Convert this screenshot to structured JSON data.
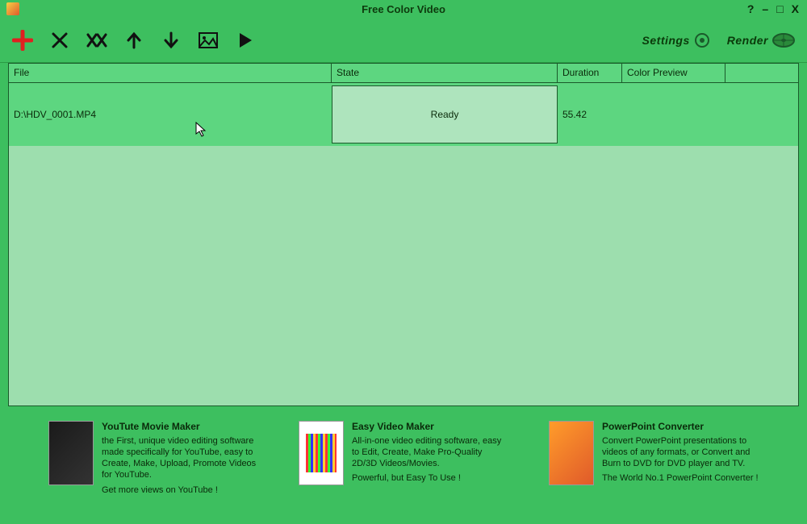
{
  "window": {
    "title": "Free Color Video"
  },
  "toolbar": {
    "settings_label": "Settings",
    "render_label": "Render"
  },
  "table": {
    "headers": {
      "file": "File",
      "state": "State",
      "duration": "Duration",
      "preview": "Color Preview"
    },
    "rows": [
      {
        "file": "D:\\HDV_0001.MP4",
        "state": "Ready",
        "duration": "55.42"
      }
    ]
  },
  "promos": [
    {
      "title": "YouTute Movie Maker",
      "desc": "the First, unique video editing software made specifically for YouTube, easy to Create, Make, Upload, Promote Videos for YouTube.",
      "tagline": "Get more views on YouTube !"
    },
    {
      "title": "Easy Video Maker",
      "desc": "All-in-one video editing software, easy to Edit, Create, Make Pro-Quality 2D/3D Videos/Movies.",
      "tagline": "Powerful, but Easy To Use !"
    },
    {
      "title": "PowerPoint Converter",
      "desc": "Convert PowerPoint presentations to videos of any formats, or Convert and Burn to DVD for DVD player and TV.",
      "tagline": "The World No.1 PowerPoint Converter !"
    }
  ]
}
